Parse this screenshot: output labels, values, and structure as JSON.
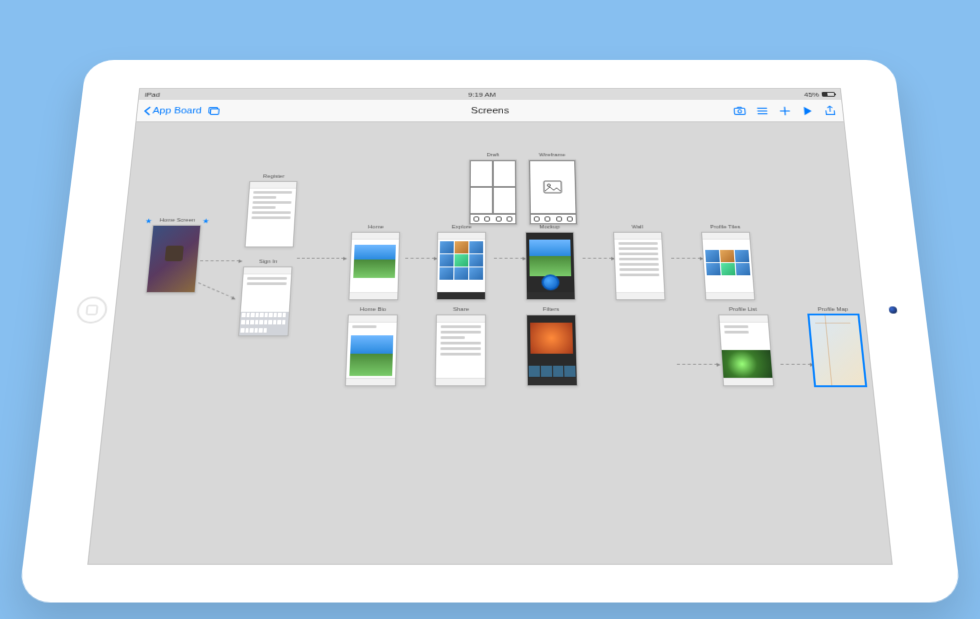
{
  "statusbar": {
    "device": "iPad",
    "time": "9:19 AM",
    "battery": "45%"
  },
  "navbar": {
    "back_label": "App Board",
    "title": "Screens"
  },
  "screens": {
    "home": {
      "label": "Home Screen"
    },
    "register": {
      "label": "Register"
    },
    "signin": {
      "label": "Sign In"
    },
    "draft": {
      "label": "Draft"
    },
    "wireframe": {
      "label": "Wireframe"
    },
    "home_feed": {
      "label": "Home"
    },
    "explore": {
      "label": "Explore"
    },
    "mockup": {
      "label": "Mockup"
    },
    "wall": {
      "label": "Wall"
    },
    "profile_tiles": {
      "label": "Profile Tiles"
    },
    "home_bio": {
      "label": "Home Bio"
    },
    "share": {
      "label": "Share"
    },
    "filters": {
      "label": "Filters"
    },
    "profile_list": {
      "label": "Profile List"
    },
    "profile_map": {
      "label": "Profile Map"
    }
  }
}
